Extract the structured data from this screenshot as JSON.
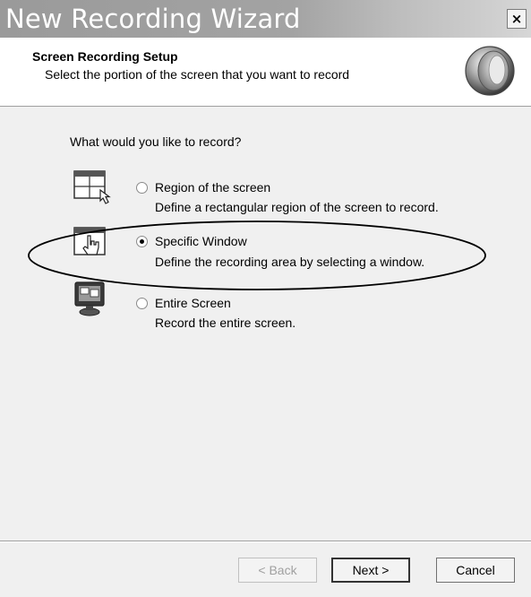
{
  "window": {
    "title": "New Recording Wizard",
    "close_label": "×"
  },
  "header": {
    "title": "Screen Recording Setup",
    "subtitle": "Select the portion of the screen that you want to record",
    "logo_icon": "recorder-logo-icon"
  },
  "body": {
    "question": "What would you like to record?",
    "options": [
      {
        "label": "Region of the screen",
        "description": "Define a rectangular region of the screen to record.",
        "icon": "region-select-icon",
        "selected": false
      },
      {
        "label": "Specific Window",
        "description": "Define the recording area by selecting a window.",
        "icon": "window-select-icon",
        "selected": true
      },
      {
        "label": "Entire Screen",
        "description": "Record the entire screen.",
        "icon": "monitor-icon",
        "selected": false
      }
    ]
  },
  "footer": {
    "back_label": "< Back",
    "next_label": "Next >",
    "cancel_label": "Cancel"
  }
}
